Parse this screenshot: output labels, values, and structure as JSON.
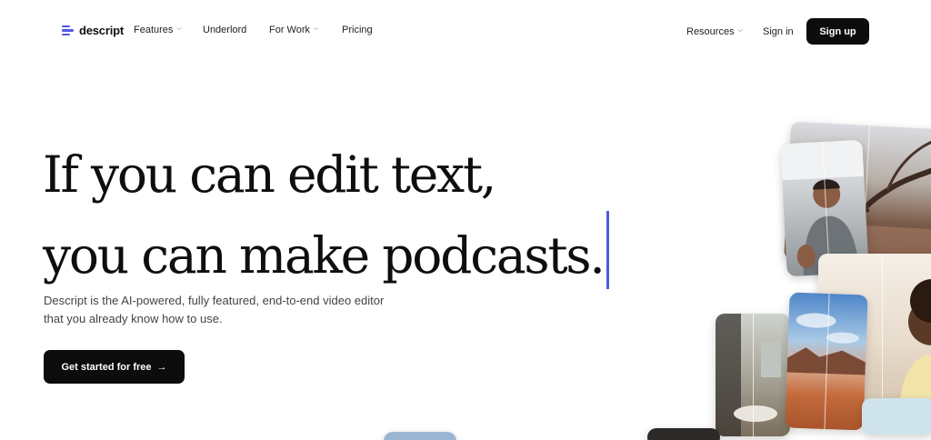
{
  "brand": {
    "name": "descript",
    "accent": "#4f58e6"
  },
  "nav": {
    "features": "Features",
    "underlord": "Underlord",
    "for_work": "For Work",
    "pricing": "Pricing",
    "resources": "Resources",
    "sign_in": "Sign in",
    "sign_up": "Sign up"
  },
  "hero": {
    "headline_line1": "If you can edit text,",
    "headline_line2": "you can make podcasts.",
    "subtext_line1": "Descript is the AI-powered, fully featured, end-to-end video editor",
    "subtext_line2": "that you already know how to use.",
    "cta_label": "Get started for free",
    "cta_arrow": "→"
  },
  "collage": {
    "cards": [
      "tree-scene",
      "man-presenter",
      "woman-smiling",
      "desert-scene",
      "kitchen-scene"
    ]
  },
  "colors": {
    "button_bg": "#0c0c0c",
    "text": "#111111"
  }
}
